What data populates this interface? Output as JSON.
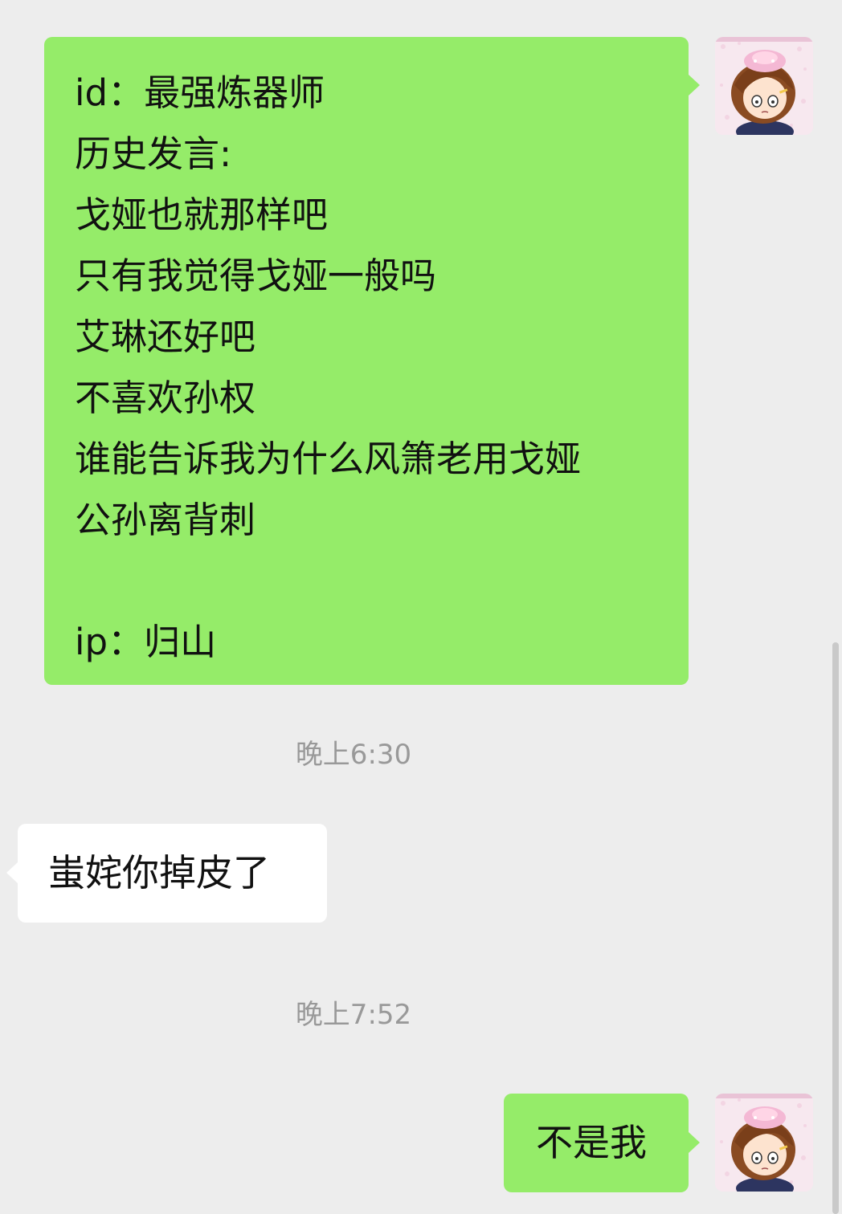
{
  "messages": [
    {
      "direction": "outgoing",
      "lines": [
        "id：最强炼器师",
        "历史发言:",
        "戈娅也就那样吧",
        "只有我觉得戈娅一般吗",
        "艾琳还好吧",
        "不喜欢孙权",
        "谁能告诉我为什么风箫老用戈娅",
        "公孙离背刺",
        "",
        "ip：归山"
      ]
    },
    {
      "type": "timestamp",
      "text": "晚上6:30"
    },
    {
      "direction": "incoming",
      "text": "蚩姹你掉皮了"
    },
    {
      "type": "timestamp",
      "text": "晚上7:52"
    },
    {
      "direction": "outgoing",
      "text": "不是我"
    }
  ],
  "colors": {
    "background": "#ededed",
    "outgoing_bubble": "#95ec69",
    "incoming_bubble": "#ffffff",
    "timestamp_text": "#999999"
  },
  "avatar": {
    "icon": "anime-character-avatar-icon"
  }
}
